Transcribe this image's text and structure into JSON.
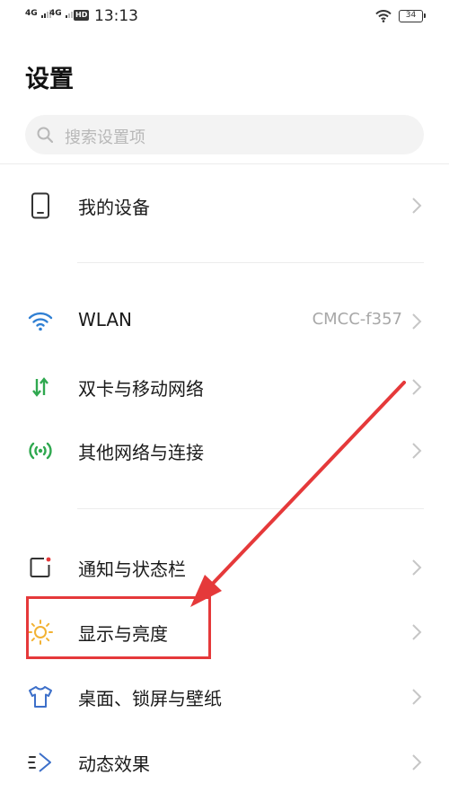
{
  "status_bar": {
    "signal_1": "4G",
    "signal_2": "4G",
    "hd_badge": "HD",
    "time": "13:13",
    "battery": "34"
  },
  "page": {
    "title": "设置",
    "search_placeholder": "搜索设置项"
  },
  "sections": [
    {
      "items": [
        {
          "label": "我的设备",
          "icon": "phone-icon"
        }
      ]
    },
    {
      "items": [
        {
          "label": "WLAN",
          "value": "CMCC-f357",
          "icon": "wifi-icon"
        },
        {
          "label": "双卡与移动网络",
          "icon": "data-arrows-icon"
        },
        {
          "label": "其他网络与连接",
          "icon": "hotspot-icon"
        }
      ]
    },
    {
      "items": [
        {
          "label": "通知与状态栏",
          "icon": "notification-icon"
        },
        {
          "label": "显示与亮度",
          "icon": "sun-icon",
          "highlighted": true
        },
        {
          "label": "桌面、锁屏与壁纸",
          "icon": "shirt-icon"
        },
        {
          "label": "动态效果",
          "icon": "motion-icon"
        }
      ]
    }
  ],
  "colors": {
    "wifi_blue": "#2f7fd3",
    "green": "#2fa84f",
    "sun_orange": "#f2b233",
    "shirt_blue": "#3c6fc9",
    "annotation_red": "#e5393a"
  }
}
